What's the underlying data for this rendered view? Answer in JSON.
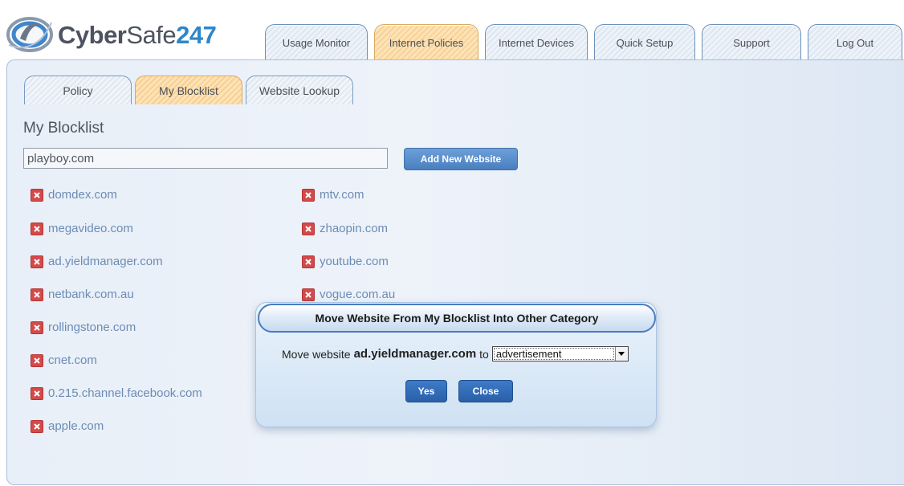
{
  "brand": {
    "name_part1": "Cyber",
    "name_part2": "Safe",
    "name_part3": "247"
  },
  "top_tabs": [
    {
      "label": "Usage Monitor",
      "active": false
    },
    {
      "label": "Internet Policies",
      "active": true
    },
    {
      "label": "Internet Devices",
      "active": false
    },
    {
      "label": "Quick Setup",
      "active": false
    },
    {
      "label": "Support",
      "active": false
    },
    {
      "label": "Log Out",
      "active": false
    }
  ],
  "sub_tabs": [
    {
      "label": "Policy",
      "active": false
    },
    {
      "label": "My Blocklist",
      "active": true
    },
    {
      "label": "Website Lookup",
      "active": false
    }
  ],
  "page_title": "My Blocklist",
  "website_input": {
    "value": "playboy.com"
  },
  "add_button_label": "Add New Website",
  "blocklist_left": [
    "domdex.com",
    "megavideo.com",
    "ad.yieldmanager.com",
    "netbank.com.au",
    "rollingstone.com",
    "cnet.com",
    "0.215.channel.facebook.com",
    "apple.com"
  ],
  "blocklist_right": [
    "mtv.com",
    "zhaopin.com",
    "youtube.com",
    "vogue.com.au"
  ],
  "modal": {
    "title": "Move Website From My Blocklist Into Other Category",
    "prefix": "Move website",
    "website": "ad.yieldmanager.com",
    "to_word": "to",
    "selected_category": "advertisement",
    "yes_label": "Yes",
    "close_label": "Close"
  },
  "colors": {
    "accent_tab": "#f8d19a",
    "link": "#6d8cb4",
    "remove_icon": "#d44a4a",
    "button": "#2a5fa8"
  }
}
